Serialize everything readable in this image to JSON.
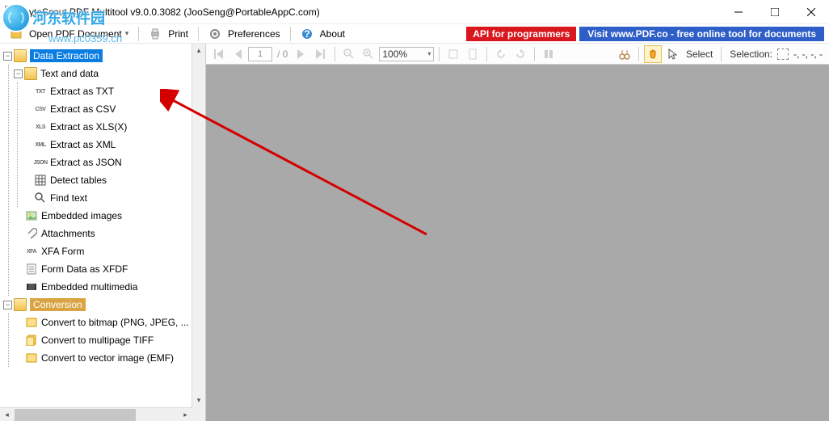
{
  "window": {
    "title": "ByteScout PDF Multitool v9.0.0.3082 (JooSeng@PortableAppC.com)"
  },
  "watermark": {
    "text": "河东软件园",
    "url": "www.pc0359.cn"
  },
  "menu": {
    "open": "Open PDF Document",
    "print": "Print",
    "prefs": "Preferences",
    "about": "About",
    "api": "API for programmers",
    "pdfco": "Visit www.PDF.co - free online tool for documents"
  },
  "tree": {
    "data_extraction": "Data Extraction",
    "text_and_data": "Text and data",
    "extract_txt": "Extract as TXT",
    "extract_csv": "Extract as CSV",
    "extract_xls": "Extract as XLS(X)",
    "extract_xml": "Extract as XML",
    "extract_json": "Extract as JSON",
    "detect_tables": "Detect tables",
    "find_text": "Find text",
    "embedded_images": "Embedded images",
    "attachments": "Attachments",
    "xfa_form": "XFA Form",
    "form_data": "Form Data as XFDF",
    "embedded_mm": "Embedded multimedia",
    "conversion": "Conversion",
    "conv_bitmap": "Convert to bitmap (PNG, JPEG, ...",
    "conv_tiff": "Convert to multipage TIFF",
    "conv_vector": "Convert to vector image (EMF)"
  },
  "toolbar": {
    "page": "1",
    "total": "/ 0",
    "zoom": "100%",
    "select": "Select",
    "selection_lbl": "Selection:",
    "selection_val": "-, -, -, -"
  }
}
